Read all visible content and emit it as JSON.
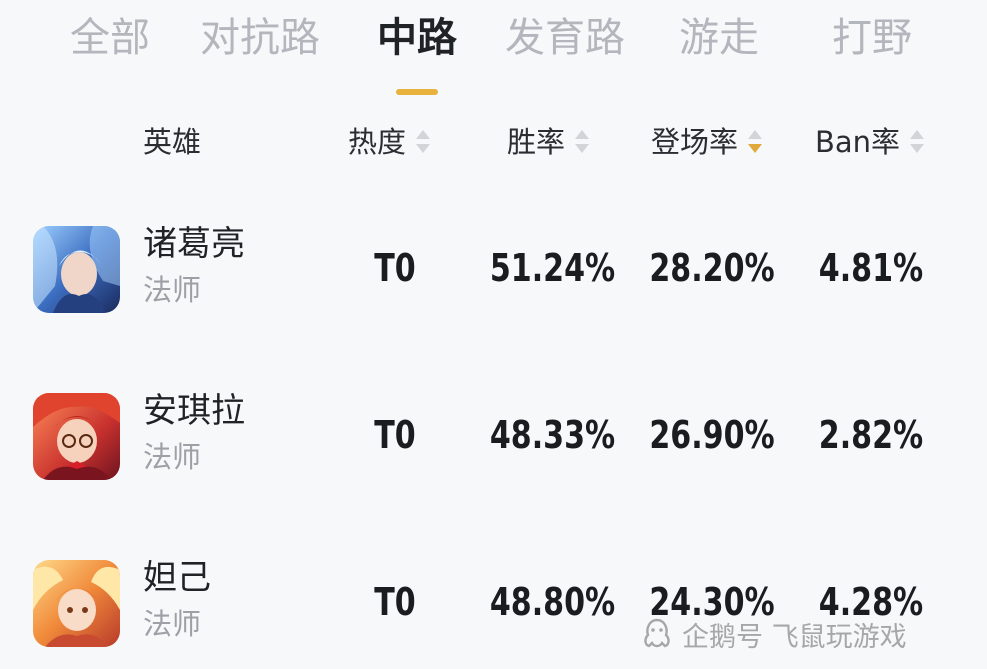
{
  "tabs": [
    {
      "label": "全部",
      "active": false
    },
    {
      "label": "对抗路",
      "active": false
    },
    {
      "label": "中路",
      "active": true
    },
    {
      "label": "发育路",
      "active": false
    },
    {
      "label": "游走",
      "active": false
    },
    {
      "label": "打野",
      "active": false
    }
  ],
  "columns": {
    "hero": "英雄",
    "heat": "热度",
    "win_rate": "胜率",
    "pick_rate": "登场率",
    "ban_rate": "Ban率"
  },
  "sort": {
    "column": "pick_rate",
    "direction": "desc"
  },
  "rows": [
    {
      "name": "诸葛亮",
      "role": "法师",
      "heat": "T0",
      "win_rate": "51.24%",
      "pick_rate": "28.20%",
      "ban_rate": "4.81%"
    },
    {
      "name": "安琪拉",
      "role": "法师",
      "heat": "T0",
      "win_rate": "48.33%",
      "pick_rate": "26.90%",
      "ban_rate": "2.82%"
    },
    {
      "name": "妲己",
      "role": "法师",
      "heat": "T0",
      "win_rate": "48.80%",
      "pick_rate": "24.30%",
      "ban_rate": "4.28%"
    }
  ],
  "watermark": "企鹅号 飞鼠玩游戏",
  "colors": {
    "accent": "#e8b23e",
    "tab_inactive": "#b3b6bc",
    "text_primary": "#1f2326",
    "text_secondary": "#9da1a7",
    "background": "#f7f8fa"
  }
}
